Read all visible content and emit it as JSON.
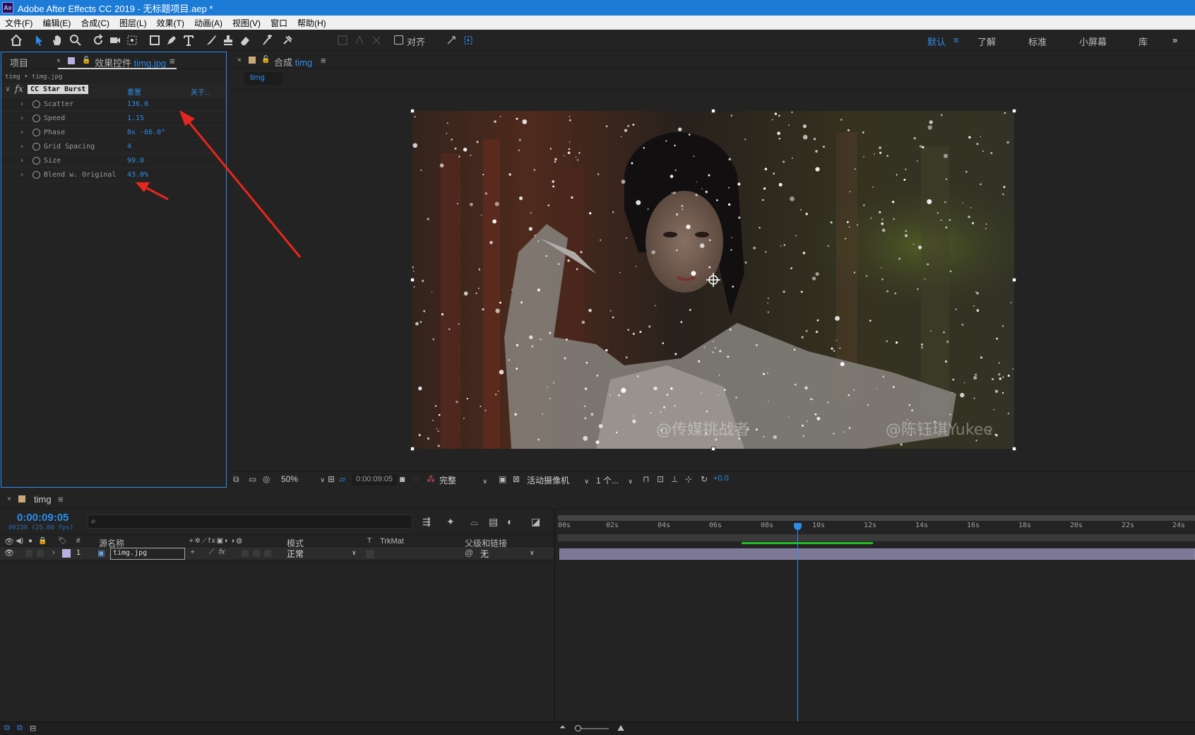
{
  "app": {
    "title": "Adobe After Effects CC 2019 - 无标题项目.aep *",
    "logo": "Ae"
  },
  "menu": [
    "文件(F)",
    "编辑(E)",
    "合成(C)",
    "图层(L)",
    "效果(T)",
    "动画(A)",
    "视图(V)",
    "窗口",
    "帮助(H)"
  ],
  "toolbar": {
    "align_label": "对齐",
    "workspaces": [
      "默认",
      "了解",
      "标准",
      "小屏幕",
      "库"
    ],
    "active_workspace": "默认",
    "more": "»"
  },
  "project_panel": {
    "tab_project": "项目",
    "tab_effects_prefix": "效果控件",
    "tab_effects_layer": "timg.jpg",
    "breadcrumb": "timg • timg.jpg",
    "effect_name": "CC Star Burst",
    "reset_label": "重置",
    "about_label": "关于...",
    "params": [
      {
        "name": "Scatter",
        "value": "136.0"
      },
      {
        "name": "Speed",
        "value": "1.15"
      },
      {
        "name": "Phase",
        "value": "0x -66.0°"
      },
      {
        "name": "Grid Spacing",
        "value": "4"
      },
      {
        "name": "Size",
        "value": "99.0"
      },
      {
        "name": "Blend w. Original",
        "value": "43.0%"
      }
    ]
  },
  "comp_panel": {
    "tab_prefix": "合成",
    "tab_comp": "timg",
    "subtab": "timg",
    "watermark_left": "@传媒挑战者",
    "watermark_right": "@陈钰琪Yukee",
    "footer": {
      "zoom": "50%",
      "timecode": "0:00:09:05",
      "resolution": "完整",
      "camera": "活动摄像机",
      "views": "1 个...",
      "exposure": "+0.0"
    }
  },
  "timeline": {
    "tab": "timg",
    "current_time": "0:00:09:05",
    "frame_info": "00230 (25.00 fps)",
    "columns": {
      "source_name": "源名称",
      "mode": "模式",
      "t": "T",
      "trkmat": "TrkMat",
      "parent": "父级和链接"
    },
    "ruler": [
      "00s",
      "02s",
      "04s",
      "06s",
      "08s",
      "10s",
      "12s",
      "14s",
      "16s",
      "18s",
      "20s",
      "22s",
      "24s"
    ],
    "layer": {
      "index": "1",
      "name": "timg.jpg",
      "mode": "正常",
      "parent": "无"
    }
  },
  "colors": {
    "accent": "#2d8ceb",
    "titlebar": "#1c7bd6",
    "annotation_arrow": "#e8261d"
  }
}
